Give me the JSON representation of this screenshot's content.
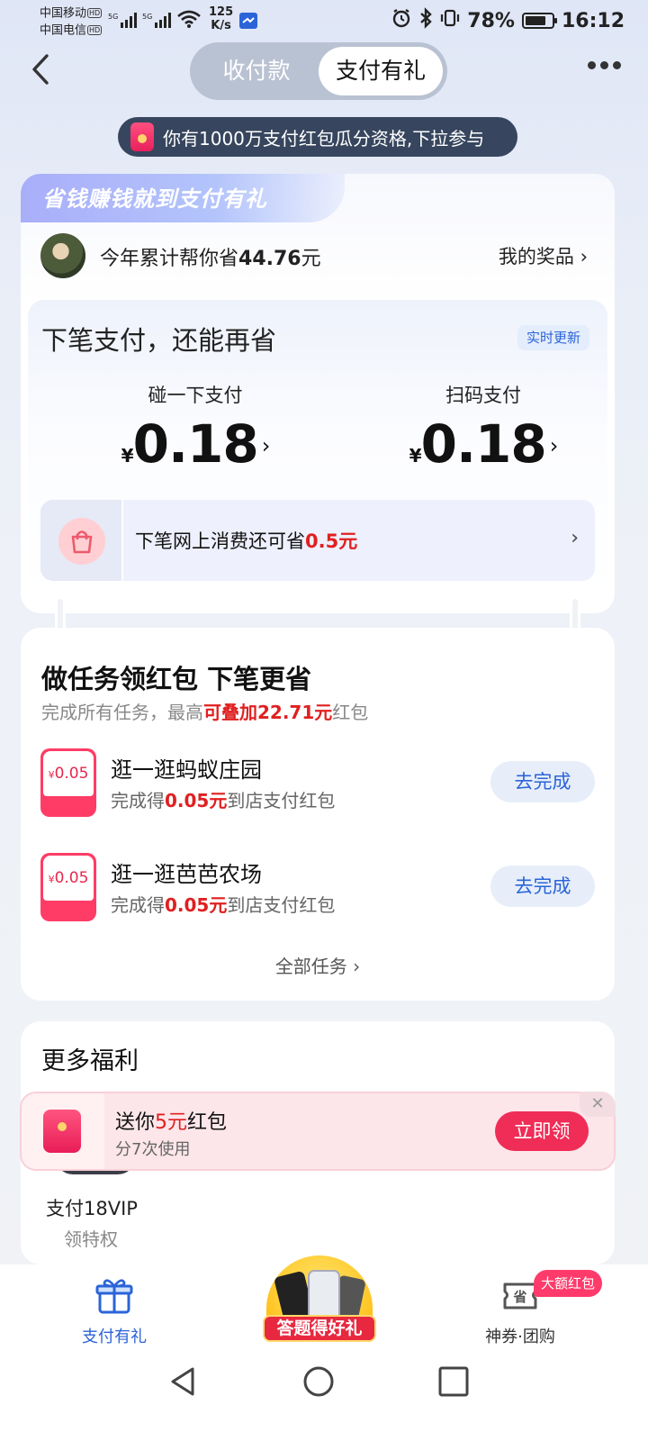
{
  "status_bar": {
    "carrier1": "中国移动",
    "carrier2": "中国电信",
    "carrier_badge": "HD",
    "sig1": "5G",
    "sig2": "5G",
    "net_speed_value": "125",
    "net_speed_unit": "K/s",
    "battery": "78%",
    "battery_level": 0.78,
    "time": "16:12"
  },
  "header": {
    "tabs": [
      "收付款",
      "支付有礼"
    ],
    "active_tab": "支付有礼"
  },
  "banner": {
    "text": "你有1000万支付红包瓜分资格,下拉参与"
  },
  "summary": {
    "slogan": "省钱赚钱就到支付有礼",
    "saved_prefix": "今年累计帮你省",
    "saved_amount": "44.76",
    "saved_suffix": "元",
    "prizes_label": "我的奖品",
    "chevron": "›"
  },
  "next_payment": {
    "title": "下笔支付，还能再省",
    "tag": "实时更新",
    "currency": "¥",
    "options": [
      {
        "label": "碰一下支付",
        "amount": "0.18"
      },
      {
        "label": "扫码支付",
        "amount": "0.18"
      }
    ],
    "online_prefix": "下笔网上消费还可省",
    "online_amount": "0.5元"
  },
  "tasks": {
    "title": "做任务领红包 下笔更省",
    "sub_prefix": "完成所有任务，最高",
    "sub_highlight": "可叠加22.71元",
    "sub_suffix": "红包",
    "items": [
      {
        "coupon_value": "0.05",
        "name": "逛一逛蚂蚁庄园",
        "desc_prefix": "完成得",
        "desc_amount": "0.05元",
        "desc_suffix": "到店支付红包",
        "button": "去完成"
      },
      {
        "coupon_value": "0.05",
        "name": "逛一逛芭芭农场",
        "desc_prefix": "完成得",
        "desc_amount": "0.05元",
        "desc_suffix": "到店支付红包",
        "button": "去完成"
      }
    ],
    "all_tasks": "全部任务 ›"
  },
  "more_benefits": {
    "title": "更多福利",
    "vip_title": "支付18VIP",
    "vip_sub": "领特权"
  },
  "promo": {
    "t1_prefix": "送你",
    "t1_amount": "5元",
    "t1_suffix": "红包",
    "t2": "分7次使用",
    "button": "立即领",
    "close": "✕"
  },
  "tabbar": {
    "tab1": "支付有礼",
    "quiz": "答题得好礼",
    "tab3": "神券·团购",
    "tab3_badge": "大额红包",
    "tab3_icon_char": "省"
  },
  "colors": {
    "accent_blue": "#2b64d9",
    "red": "#e02020",
    "promo_red": "#ef2d57"
  }
}
